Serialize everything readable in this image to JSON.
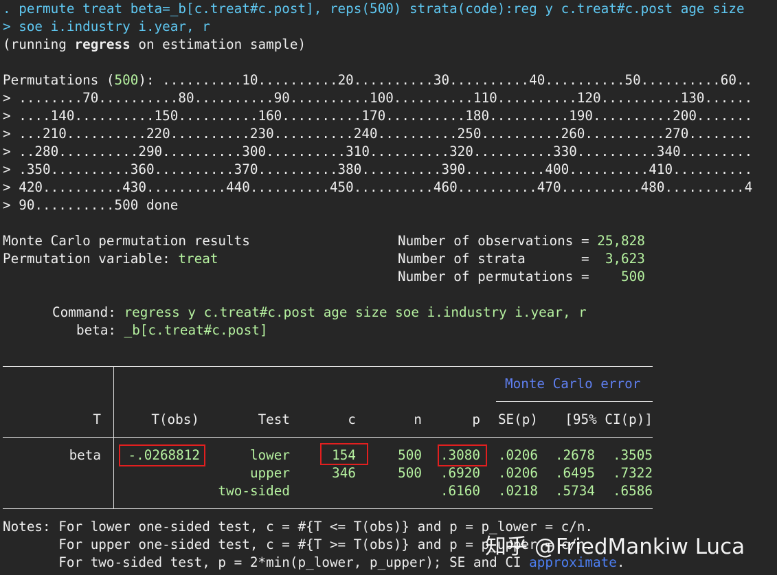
{
  "colors": {
    "background": "#262626",
    "text": "#eeeeee",
    "command": "#5fc8f2",
    "result": "#b6f2a0",
    "link": "#4d7ff3",
    "highlight": "#e21f1f"
  },
  "command": {
    "line1": ". permute treat beta=_b[c.treat#c.post], reps(500) strata(code):reg y c.treat#c.post age size",
    "line2": "> soe i.industry i.year, r"
  },
  "running": {
    "pre": "(running ",
    "word": "regress",
    "post": " on estimation sample)"
  },
  "permutations": {
    "label_pre": "Permutations (",
    "count": "500",
    "label_post": "): ..........10..........20..........30..........40..........50..........60..",
    "lines": [
      "> ........70..........80..........90..........100..........110..........120..........130......",
      "> ....140..........150..........160..........170..........180..........190..........200.......",
      "> ...210..........220..........230..........240..........250..........260..........270........",
      "> ..280..........290..........300..........310..........320..........330..........340.........",
      "> .350..........360..........370..........380..........390..........400..........410..........",
      "> 420..........430..........440..........450..........460..........470..........480..........4",
      "> 90..........500 done"
    ]
  },
  "results": {
    "title": "Monte Carlo permutation results",
    "perm_var_label": "Permutation variable: ",
    "perm_var": "treat",
    "obs_label": "Number of observations = ",
    "obs": "25,828",
    "strata_label": "Number of strata       = ",
    "strata": " 3,623",
    "perms_label": "Number of permutations = ",
    "perms": "   500"
  },
  "command_info": {
    "command_label": "Command: ",
    "command": "regress y c.treat#c.post age size soe i.industry i.year, r",
    "beta_label": "beta: ",
    "beta": "_b[c.treat#c.post]"
  },
  "table": {
    "mc_header": "Monte Carlo error",
    "headers": [
      "T",
      "T(obs)",
      "Test",
      "c",
      "n",
      "p",
      "SE(p)",
      "[95% CI(p)]"
    ],
    "row_label": "beta",
    "tobs": "-.0268812",
    "rows": [
      {
        "test": "lower",
        "c": "154",
        "n": "500",
        "p": ".3080",
        "se": ".0206",
        "lo": ".2678",
        "hi": ".3505"
      },
      {
        "test": "upper",
        "c": "346",
        "n": "500",
        "p": ".6920",
        "se": ".0206",
        "lo": ".6495",
        "hi": ".7322"
      },
      {
        "test": "two-sided",
        "c": "",
        "n": "",
        "p": ".6160",
        "se": ".0218",
        "lo": ".5734",
        "hi": ".6586"
      }
    ]
  },
  "notes": {
    "line1": "Notes: For lower one-sided test, c = #{T <= T(obs)} and p = p_lower = c/n.",
    "line2": "       For upper one-sided test, c = #{T >= T(obs)} and p = p_upper = c/n.",
    "line3_pre": "       For two-sided test, p = 2*min(p_lower, p_upper); SE and CI ",
    "line3_link": "approximate",
    "line3_post": "."
  },
  "watermark": "知乎 @FriedMankiw Luca"
}
